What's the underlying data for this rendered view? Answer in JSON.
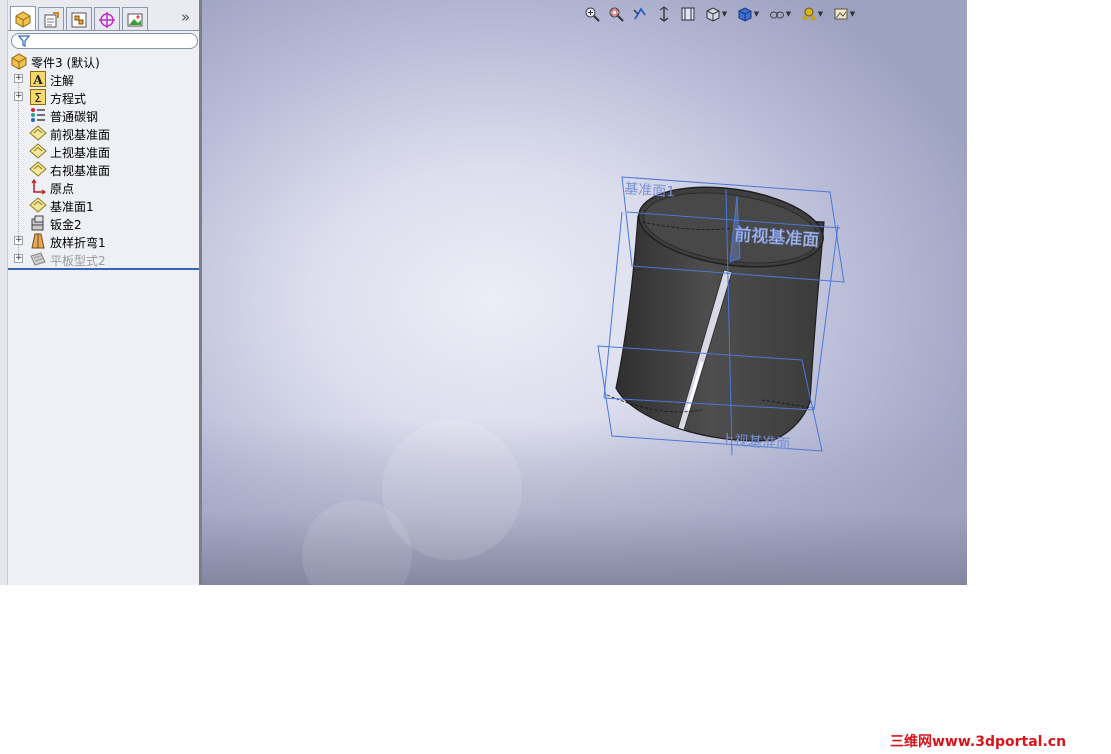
{
  "feature_tree": {
    "root_label": "零件3 (默认)",
    "items": [
      {
        "label": "注解",
        "icon": "annotations-icon",
        "expandable": true
      },
      {
        "label": "方程式",
        "icon": "equations-icon",
        "expandable": true
      },
      {
        "label": "普通碳钢",
        "icon": "material-icon",
        "expandable": false
      },
      {
        "label": "前视基准面",
        "icon": "plane-icon",
        "expandable": false
      },
      {
        "label": "上视基准面",
        "icon": "plane-icon",
        "expandable": false
      },
      {
        "label": "右视基准面",
        "icon": "plane-icon",
        "expandable": false
      },
      {
        "label": "原点",
        "icon": "origin-icon",
        "expandable": false
      },
      {
        "label": "基准面1",
        "icon": "plane-icon",
        "expandable": false
      },
      {
        "label": "钣金2",
        "icon": "sheet-metal-icon",
        "expandable": false
      },
      {
        "label": "放样折弯1",
        "icon": "lofted-bend-icon",
        "expandable": true
      },
      {
        "label": "平板型式2",
        "icon": "flat-pattern-icon",
        "expandable": true,
        "suppressed": true
      }
    ]
  },
  "tabs": [
    {
      "name": "feature-manager-tab",
      "icon": "feature-tree-icon",
      "active": true
    },
    {
      "name": "property-manager-tab",
      "icon": "property-manager-icon",
      "active": false
    },
    {
      "name": "configuration-manager-tab",
      "icon": "configuration-manager-icon",
      "active": false
    },
    {
      "name": "dimxpert-manager-tab",
      "icon": "dimxpert-icon",
      "active": false
    },
    {
      "name": "display-manager-tab",
      "icon": "display-manager-icon",
      "active": false
    }
  ],
  "expand_glyph": "»",
  "viewport": {
    "plane_labels": {
      "datum_plane1": "基准面1",
      "front_plane": "前视基准面",
      "top_plane": "上视基准面"
    },
    "toolbar_icons": [
      "zoom-to-fit-icon",
      "zoom-to-area-icon",
      "previous-view-icon",
      "section-view-icon",
      "dynamic-annotation-icon",
      "view-orientation-icon",
      "display-style-icon",
      "hide-show-items-icon",
      "edit-appearance-icon",
      "apply-scene-icon"
    ]
  },
  "watermark": "三维网www.3dportal.cn",
  "colors": {
    "plane_outline": "#4a78d8",
    "model_body": "#4a4a4a",
    "rollback_bar": "#3565b5",
    "watermark": "#d8141b"
  }
}
